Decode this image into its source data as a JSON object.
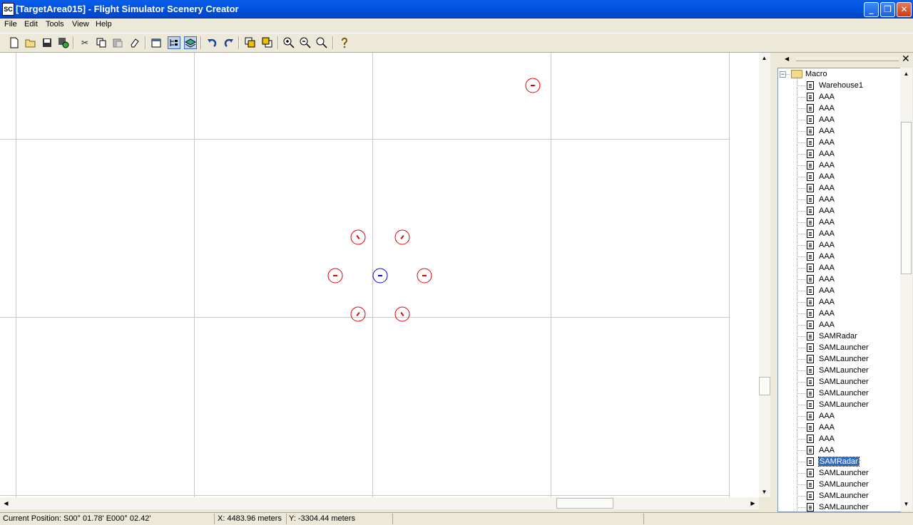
{
  "window": {
    "title": "[TargetArea015] - Flight Simulator Scenery Creator",
    "app_icon_text": "SC",
    "controls": [
      "minimize",
      "restore",
      "close"
    ]
  },
  "menu": [
    "File",
    "Edit",
    "Tools",
    "View",
    "Help"
  ],
  "toolbar": {
    "groups": [
      [
        "new-icon",
        "open-icon",
        "save-icon",
        "compile-icon"
      ],
      [
        "cut-icon",
        "copy-icon",
        "paste-icon",
        "erase-icon"
      ],
      [
        "properties-icon",
        "hierarchy-icon",
        "layer-icon"
      ],
      [
        "undo-icon",
        "redo-icon"
      ],
      [
        "bring-forward-icon",
        "send-backward-icon"
      ],
      [
        "zoom-in-icon",
        "zoom-out-icon",
        "zoom-fit-icon"
      ],
      [
        "help-icon"
      ]
    ],
    "active": [
      "hierarchy-icon",
      "layer-icon"
    ]
  },
  "map": {
    "objects": [
      {
        "name": "map-object-warehouse",
        "color": "#e00000"
      },
      {
        "name": "map-object-aaa-nw",
        "color": "#e00000"
      },
      {
        "name": "map-object-aaa-ne",
        "color": "#e00000"
      },
      {
        "name": "map-object-aaa-w",
        "color": "#e00000"
      },
      {
        "name": "map-object-samradar-center",
        "color": "#0000e0"
      },
      {
        "name": "map-object-aaa-e",
        "color": "#e00000"
      },
      {
        "name": "map-object-aaa-sw",
        "color": "#e00000"
      },
      {
        "name": "map-object-aaa-se",
        "color": "#e00000"
      }
    ]
  },
  "tree": {
    "root_label": "Macro",
    "items": [
      "Warehouse1",
      "AAA",
      "AAA",
      "AAA",
      "AAA",
      "AAA",
      "AAA",
      "AAA",
      "AAA",
      "AAA",
      "AAA",
      "AAA",
      "AAA",
      "AAA",
      "AAA",
      "AAA",
      "AAA",
      "AAA",
      "AAA",
      "AAA",
      "AAA",
      "AAA",
      "SAMRadar",
      "SAMLauncher",
      "SAMLauncher",
      "SAMLauncher",
      "SAMLauncher",
      "SAMLauncher",
      "SAMLauncher",
      "AAA",
      "AAA",
      "AAA",
      "AAA",
      "SAMRadar",
      "SAMLauncher",
      "SAMLauncher",
      "SAMLauncher",
      "SAMLauncher"
    ],
    "selected_index": 33
  },
  "status": {
    "position": "Current Position: S00° 01.78'  E000° 02.42'",
    "x": "X: 4483.96 meters",
    "y": "Y: -3304.44 meters"
  }
}
